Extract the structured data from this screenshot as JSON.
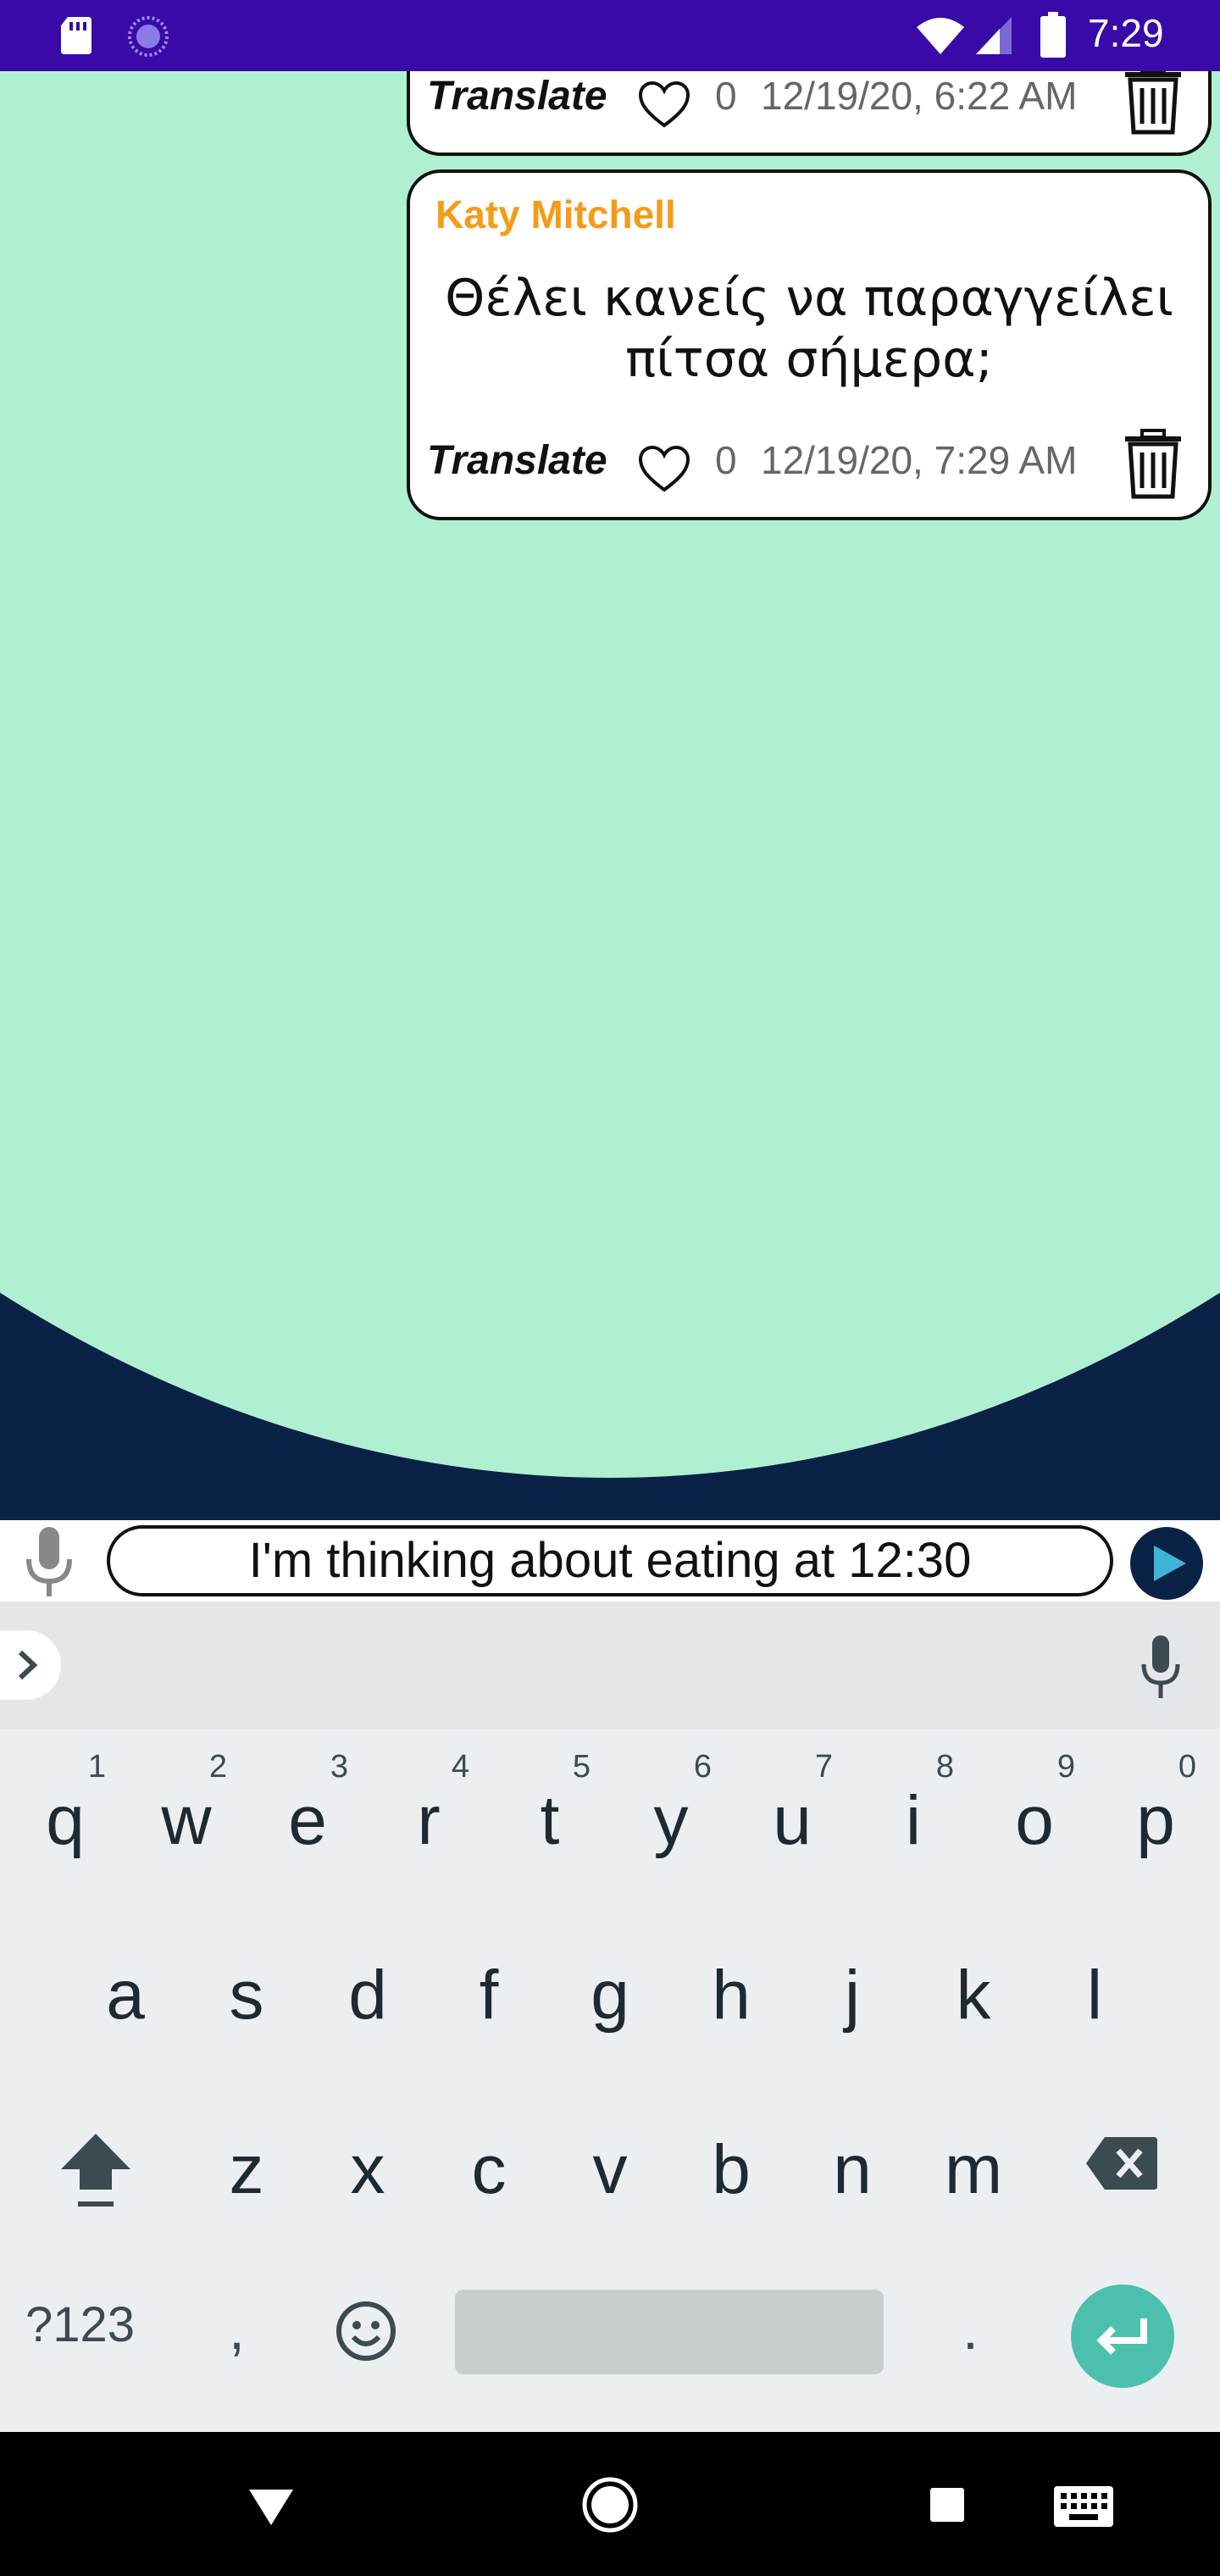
{
  "status_bar": {
    "time": "7:29",
    "icons": [
      "sd-card-icon",
      "spinner-icon",
      "wifi-icon",
      "signal-icon",
      "battery-icon"
    ]
  },
  "messages": [
    {
      "sender": "",
      "text": "",
      "translate_label": "Translate",
      "likes": "0",
      "timestamp": "12/19/20, 6:22 AM"
    },
    {
      "sender": "Katy Mitchell",
      "text": "Θέλει κανείς να παραγγείλει πίτσα σήμερα;",
      "translate_label": "Translate",
      "likes": "0",
      "timestamp": "12/19/20, 7:29 AM"
    }
  ],
  "input": {
    "value": "I'm thinking about eating at 12:30"
  },
  "keyboard": {
    "row1": [
      {
        "char": "q",
        "num": "1"
      },
      {
        "char": "w",
        "num": "2"
      },
      {
        "char": "e",
        "num": "3"
      },
      {
        "char": "r",
        "num": "4"
      },
      {
        "char": "t",
        "num": "5"
      },
      {
        "char": "y",
        "num": "6"
      },
      {
        "char": "u",
        "num": "7"
      },
      {
        "char": "i",
        "num": "8"
      },
      {
        "char": "o",
        "num": "9"
      },
      {
        "char": "p",
        "num": "0"
      }
    ],
    "row2": [
      "a",
      "s",
      "d",
      "f",
      "g",
      "h",
      "j",
      "k",
      "l"
    ],
    "row3": [
      "z",
      "x",
      "c",
      "v",
      "b",
      "n",
      "m"
    ],
    "symbols_label": "?123",
    "comma_label": ",",
    "period_label": "."
  },
  "colors": {
    "status_bar": "#3a0aa8",
    "chat_background": "#b0f0d2",
    "chat_dark": "#0a2246",
    "sender_name": "#f59b18",
    "enter_key": "#4cbfad"
  }
}
